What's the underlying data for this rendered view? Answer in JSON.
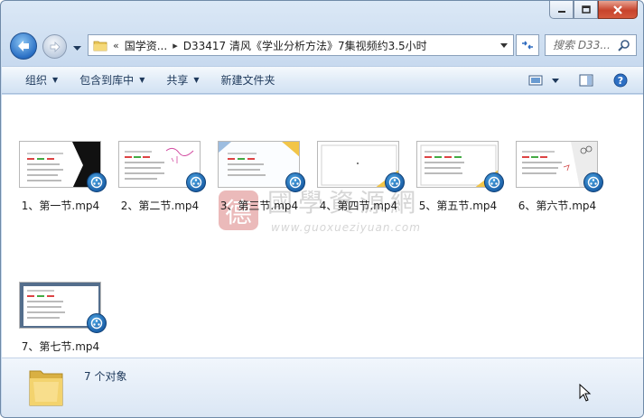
{
  "window": {
    "buttons": {
      "minimize": "minimize-icon",
      "maximize": "maximize-icon",
      "close": "close-icon"
    }
  },
  "address": {
    "overflow": "«",
    "crumbs": [
      "国学资...",
      "D33417 清风《学业分析方法》7集视频约3.5小时"
    ],
    "separator": "▸"
  },
  "search": {
    "placeholder": "搜索 D33..."
  },
  "toolbar": {
    "organize": "组织",
    "include_library": "包含到库中",
    "share": "共享",
    "new_folder": "新建文件夹"
  },
  "files": [
    {
      "name": "1、第一节.mp4"
    },
    {
      "name": "2、第二节.mp4"
    },
    {
      "name": "3、第三节.mp4"
    },
    {
      "name": "4、第四节.mp4"
    },
    {
      "name": "5、第五节.mp4"
    },
    {
      "name": "6、第六节.mp4"
    },
    {
      "name": "7、第七节.mp4"
    }
  ],
  "watermark": {
    "seal": "德",
    "text": "國學資源網",
    "url": "www.guoxueziyuan.com"
  },
  "status": {
    "count": "7 个对象"
  },
  "colors": {
    "accent": "#1e395b",
    "badge": "#1a5ea6",
    "close": "#c7432c"
  }
}
